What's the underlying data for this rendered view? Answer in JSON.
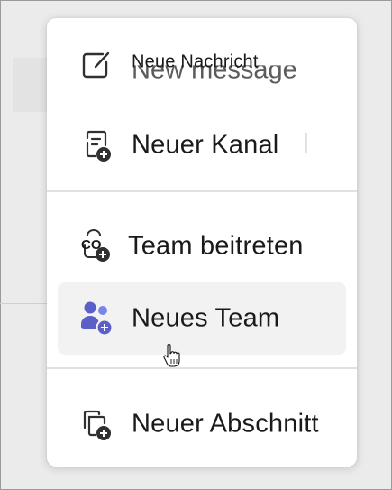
{
  "menu": {
    "items": [
      {
        "label": "Neue Nachricht",
        "underlay": "New message",
        "icon": "compose-icon"
      },
      {
        "label": "Neuer Kanal",
        "icon": "add-channel-icon"
      },
      {
        "label": "Team beitreten",
        "icon": "join-team-icon",
        "icon_text": "CO"
      },
      {
        "label": "Neues Team",
        "icon": "new-team-icon"
      },
      {
        "label": "Neuer Abschnitt",
        "icon": "new-section-icon"
      }
    ],
    "hovered_item": "Neues Team",
    "accent_color": "#5b5fc7"
  }
}
